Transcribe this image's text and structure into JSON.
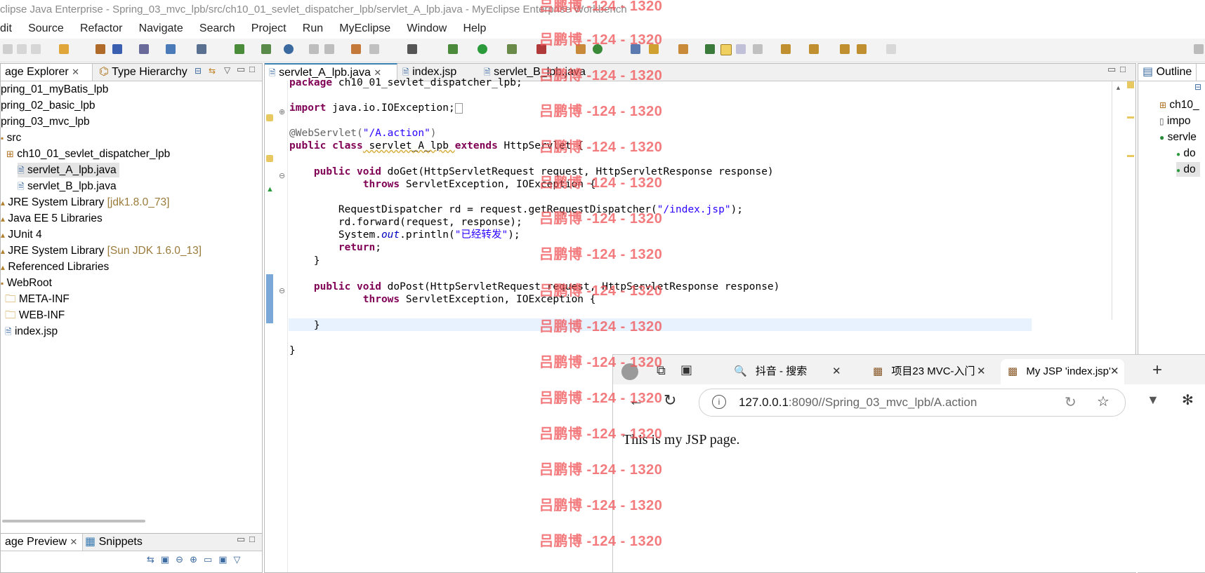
{
  "window": {
    "title": "clipse Java Enterprise - Spring_03_mvc_lpb/src/ch10_01_sevlet_dispatcher_lpb/servlet_A_lpb.java - MyEclipse Enterprise Workbench"
  },
  "menu": [
    "dit",
    "Source",
    "Refactor",
    "Navigate",
    "Search",
    "Project",
    "Run",
    "MyEclipse",
    "Window",
    "Help"
  ],
  "explorer": {
    "tabs": [
      "age Explorer",
      "Type Hierarchy"
    ],
    "tree": [
      {
        "label": "pring_01_myBatis_lpb",
        "extra": ""
      },
      {
        "label": "pring_02_basic_lpb",
        "extra": ""
      },
      {
        "label": "pring_03_mvc_lpb",
        "extra": ""
      },
      {
        "label": "src",
        "extra": ""
      },
      {
        "label": "ch10_01_sevlet_dispatcher_lpb",
        "extra": ""
      },
      {
        "label": "servlet_A_lpb.java",
        "extra": ""
      },
      {
        "label": "servlet_B_lpb.java",
        "extra": ""
      },
      {
        "label": "JRE System Library ",
        "extra": "[jdk1.8.0_73]"
      },
      {
        "label": "Java EE 5 Libraries",
        "extra": ""
      },
      {
        "label": "JUnit 4",
        "extra": ""
      },
      {
        "label": "JRE System Library ",
        "extra": "[Sun JDK 1.6.0_13]"
      },
      {
        "label": "Referenced Libraries",
        "extra": ""
      },
      {
        "label": "WebRoot",
        "extra": ""
      },
      {
        "label": "META-INF",
        "extra": ""
      },
      {
        "label": "WEB-INF",
        "extra": ""
      },
      {
        "label": "index.jsp",
        "extra": ""
      }
    ]
  },
  "bottom_left": {
    "tabs": [
      "age Preview",
      "Snippets"
    ]
  },
  "editor": {
    "tabs": [
      "servlet_A_lpb.java",
      "index.jsp",
      "servlet_B_lpb.java"
    ],
    "lines": {
      "l1": "package",
      "l1b": " ch10_01_sevlet_dispatcher_lpb;",
      "l2": "import",
      "l2b": " java.io.IOException;",
      "l3": "@WebServlet(",
      "l3s": "\"/A.action\"",
      "l3e": ")",
      "l4a": "public class",
      "l4b": " servlet_A_lpb ",
      "l4c": "extends",
      "l4d": " HttpServlet {",
      "l5a": "    public void",
      "l5b": " doGet(HttpServletRequest request, HttpServletResponse response)",
      "l6a": "            throws",
      "l6b": " ServletException, IOException {",
      "l7a": "        RequestDispatcher rd = request.getRequestDispatcher(",
      "l7s": "\"/index.jsp\"",
      "l7e": ");",
      "l8": "        rd.forward(request, response);",
      "l9a": "        System.",
      "l9b": "out",
      "l9c": ".println(",
      "l9s": "\"已经转发\"",
      "l9e": ");",
      "l10a": "        return",
      "l10b": ";",
      "l11": "    }",
      "l12a": "    public void",
      "l12b": " doPost(HttpServletRequest request, HttpServletResponse response)",
      "l13a": "            throws",
      "l13b": " ServletException, IOException {",
      "l14": "    }",
      "l15": "}"
    }
  },
  "outline": {
    "title": "Outline",
    "items": [
      "ch10_",
      "impo",
      "servle",
      "do",
      "do"
    ]
  },
  "browser": {
    "tabs": [
      "抖音 - 搜索",
      "项目23 MVC-入门",
      "My JSP 'index.jsp'"
    ],
    "url_host": "127.0.0.1",
    "url_rest": ":8090//Spring_03_mvc_lpb/A.action",
    "content": "This is my JSP page."
  },
  "watermark": "吕鹏博 -124 - 1320",
  "colors": {
    "accent": "#3c7fb1",
    "keyword": "#7f0055",
    "string": "#2a00ff",
    "watermark": "#f0575a"
  }
}
